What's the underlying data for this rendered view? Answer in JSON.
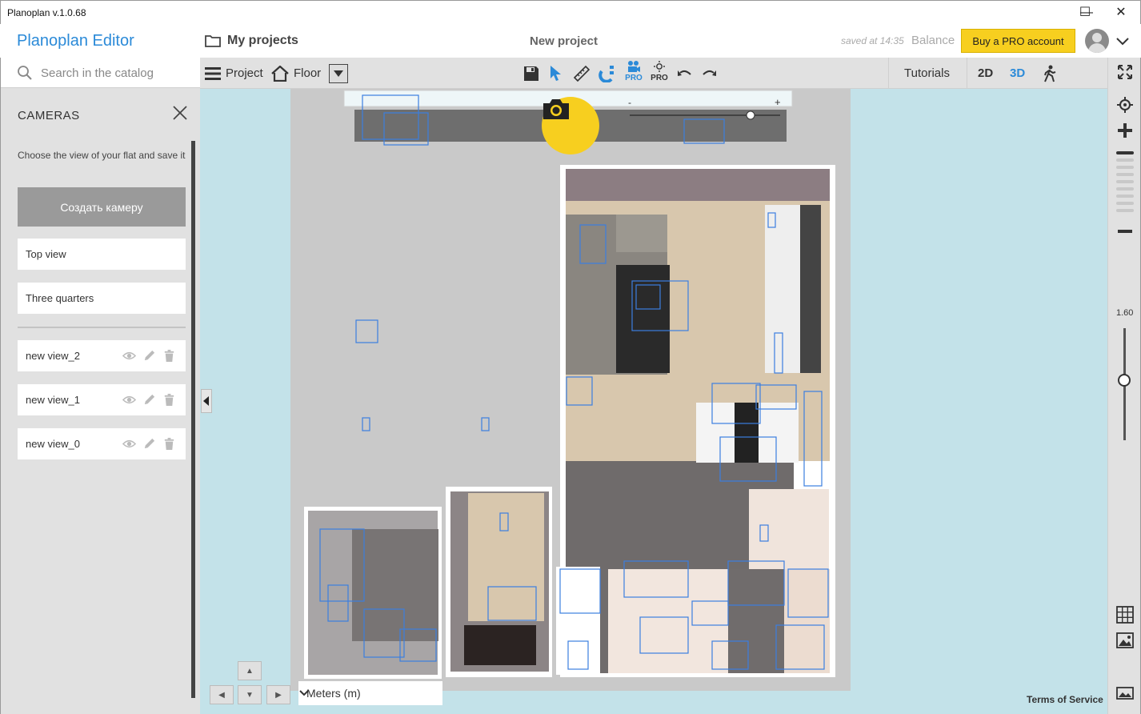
{
  "window": {
    "title": "Planoplan v.1.0.68",
    "minimize": "—",
    "maximize": "☐",
    "close": "✕"
  },
  "header": {
    "brand": "Planoplan Editor",
    "my_projects": "My projects",
    "project_name": "New project",
    "saved_at": "saved at 14:35",
    "balance": "Balance",
    "buy_pro": "Buy a PRO account"
  },
  "sidebar": {
    "search_placeholder": "Search in the catalog",
    "section_title": "CAMERAS",
    "description": "Choose the view of your flat and save it",
    "create_button": "Создать камеру",
    "presets": [
      {
        "label": "Top view"
      },
      {
        "label": "Three quarters"
      }
    ],
    "views": [
      {
        "label": "new view_2"
      },
      {
        "label": "new view_1"
      },
      {
        "label": "new view_0"
      }
    ]
  },
  "toolbar": {
    "project": "Project",
    "floor": "Floor",
    "pro_video": "PRO",
    "pro_light": "PRO",
    "tutorials": "Tutorials",
    "view_2d": "2D",
    "view_3d": "3D"
  },
  "right_panel": {
    "zoom_level": "1.60"
  },
  "canvas": {
    "units": "Meters (m)",
    "terms": "Terms of Service",
    "scale_minus": "-",
    "scale_plus": "+"
  },
  "colors": {
    "accent": "#2b8ad8",
    "pro_yellow": "#f7cf1f",
    "canvas_bg": "#c3e2e9",
    "panel_bg": "#e1e1e1"
  }
}
